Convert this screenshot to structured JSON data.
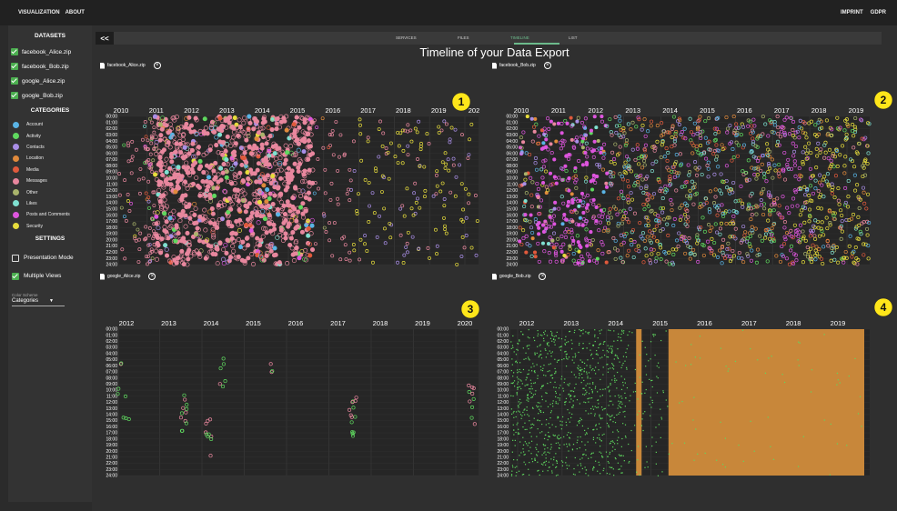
{
  "topbar": {
    "nav": [
      "VISUALIZATION",
      "ABOUT"
    ],
    "right": [
      "IMPRINT",
      "GDPR"
    ]
  },
  "sidebar": {
    "datasets_title": "DATASETS",
    "datasets": [
      {
        "label": "facebook_Alice.zip",
        "checked": true
      },
      {
        "label": "facebook_Bob.zip",
        "checked": true
      },
      {
        "label": "google_Alice.zip",
        "checked": true
      },
      {
        "label": "google_Bob.zip",
        "checked": true
      }
    ],
    "categories_title": "CATEGORIES",
    "categories": [
      {
        "label": "Account",
        "color": "#5ab4e5"
      },
      {
        "label": "Activity",
        "color": "#5fd85f"
      },
      {
        "label": "Contacts",
        "color": "#a98ee6"
      },
      {
        "label": "Location",
        "color": "#e08a3c"
      },
      {
        "label": "Media",
        "color": "#e05a3c"
      },
      {
        "label": "Messages",
        "color": "#e8879e"
      },
      {
        "label": "Other",
        "color": "#a9b36b"
      },
      {
        "label": "Likes",
        "color": "#7fe0d0"
      },
      {
        "label": "Posts and Comments",
        "color": "#dd55dd"
      },
      {
        "label": "Security",
        "color": "#e6dc3c"
      }
    ],
    "settings_title": "SETTINGS",
    "settings": [
      {
        "label": "Presentation Mode",
        "checked": false
      },
      {
        "label": "Multiple Views",
        "checked": true
      }
    ],
    "color_scheme_label": "Color Scheme",
    "color_scheme_value": "Categories"
  },
  "toolbar": {
    "collapse_label": "<<",
    "tabs": [
      "SERVICES",
      "FILES",
      "TIMELINE",
      "LIST"
    ],
    "active_tab": "TIMELINE"
  },
  "page_title": "Timeline of your Data Export",
  "hours": [
    "00:00",
    "01:00",
    "02:00",
    "03:00",
    "04:00",
    "05:00",
    "06:00",
    "07:00",
    "08:00",
    "09:00",
    "10:00",
    "11:00",
    "12:00",
    "13:00",
    "14:00",
    "15:00",
    "16:00",
    "17:00",
    "18:00",
    "19:00",
    "20:00",
    "21:00",
    "22:00",
    "23:00",
    "24:00"
  ],
  "plots": [
    {
      "file": "facebook_Alice.zip",
      "years": [
        "2010",
        "2011",
        "2012",
        "2013",
        "2014",
        "2015",
        "2016",
        "2017",
        "2018",
        "2019",
        "202"
      ],
      "badge": "1"
    },
    {
      "file": "facebook_Bob.zip",
      "years": [
        "2010",
        "2011",
        "2012",
        "2013",
        "2014",
        "2015",
        "2016",
        "2017",
        "2018",
        "2019"
      ],
      "badge": "2"
    },
    {
      "file": "google_Alice.zip",
      "years": [
        "2012",
        "2013",
        "2014",
        "2015",
        "2016",
        "2017",
        "2018",
        "2019",
        "2020"
      ],
      "badge": "3"
    },
    {
      "file": "google_Bob.zip",
      "years": [
        "2012",
        "2013",
        "2014",
        "2015",
        "2016",
        "2017",
        "2018",
        "2019"
      ],
      "badge": "4"
    }
  ]
}
